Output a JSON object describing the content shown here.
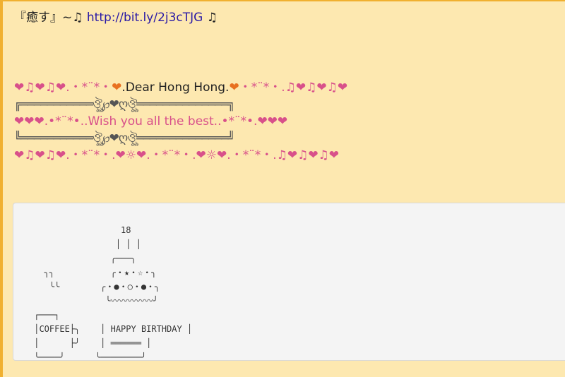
{
  "post": {
    "title_text": "『癒す』~♫ ",
    "link_text": "http://bit.ly/2j3cTJG",
    "title_suffix": " ♫"
  },
  "decoration": {
    "line1_a": "❤♫❤♫❤.・*¨*・",
    "line1_b": "❤",
    "line1_c": ".Dear Hong Hong.",
    "line1_d": "❤",
    "line1_e": "・*¨*・.♫❤♫❤♫❤",
    "frame_top": "╔═══════════ঔৣ℘❤ღঔৣ══════════════╗",
    "line3": "❤❤❤.•*¨*•..Wish you all the best..•*¨*•.❤❤❤",
    "frame_bottom": "╚═══════════ঔৣ℘❤ღঔৣ══════════════╝",
    "line5": "❤♫❤♫❤.・*¨*・.❤☼❤.・*¨*・.❤☼❤.・*¨*・.♫❤♫❤♫❤"
  },
  "ascii_art": {
    "text": "                  18\n                 │ │ │\n                ╭───╮\n   ╮╮           ╭・★・☆・╮\n    ╰╰        ╭・●・○・●・╮\n               ╰〰〰〰〰〰╯\n ┌───┐\n │COFFEE├╮    │ HAPPY BIRTHDAY │\n │      ├╯    │ ══════ │\n ╰────╯      ╰────────╯"
  },
  "colors": {
    "background": "#fde8b0",
    "heart_pink": "#d8508a",
    "heart_orange": "#e87020",
    "link": "#2a1aa6"
  }
}
